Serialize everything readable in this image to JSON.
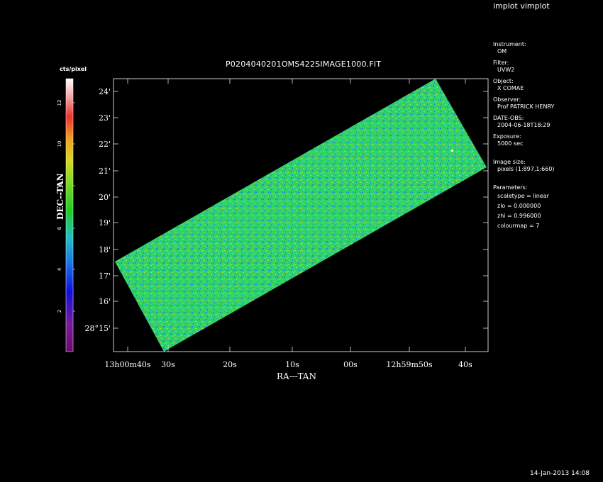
{
  "window": {
    "title": "implot vimplot",
    "timestamp": "14-Jan-2013 14:08"
  },
  "plot": {
    "title": "P0204040201OMS422SIMAGE1000.FIT",
    "xlabel": "RA---TAN",
    "ylabel": "DEC--TAN",
    "x_ticks": [
      {
        "label": "13h00m40s"
      },
      {
        "label": "30s"
      },
      {
        "label": "20s"
      },
      {
        "label": "10s"
      },
      {
        "label": "00s"
      },
      {
        "label": "12h59m50s"
      },
      {
        "label": "40s"
      }
    ],
    "y_ticks": [
      {
        "label": "24'"
      },
      {
        "label": "23'"
      },
      {
        "label": "22'"
      },
      {
        "label": "21'"
      },
      {
        "label": "20'"
      },
      {
        "label": "19'"
      },
      {
        "label": "18'"
      },
      {
        "label": "17'"
      },
      {
        "label": "16'"
      },
      {
        "label": "28°15'"
      }
    ]
  },
  "colorbar": {
    "label": "cts/pixel",
    "ticks": [
      "12",
      "10",
      "8",
      "6",
      "4",
      "2"
    ],
    "colormap": "rainbow (black-purple-blue-cyan-green-yellow-red-white)"
  },
  "info_panel": [
    {
      "key": "Instrument:",
      "value": "OM"
    },
    {
      "key": "Filter:",
      "value": "UVW2"
    },
    {
      "key": "Object:",
      "value": "X COMAE"
    },
    {
      "key": "Observer:",
      "value": "Prof PATRICK HENRY"
    },
    {
      "key": "DATE-OBS:",
      "value": "2004-06-18T18:29"
    },
    {
      "key": "Exposure:",
      "value": "5000 sec"
    },
    {
      "key": "Image size:",
      "value": "pixels (1:897,1:660)"
    },
    {
      "key": "Parameters:",
      "value": "scaletype = linear"
    },
    {
      "key": "",
      "value": "zlo = 0.000000"
    },
    {
      "key": "",
      "value": "zhi = 0.996000"
    },
    {
      "key": "",
      "value": "colourmap =   7"
    }
  ],
  "colors": {
    "background": "#000000",
    "foreground": "#ffffff",
    "image_main": "#2fd36a",
    "image_noise_a": "#1e8fd8",
    "image_noise_b": "#c6d83a"
  }
}
